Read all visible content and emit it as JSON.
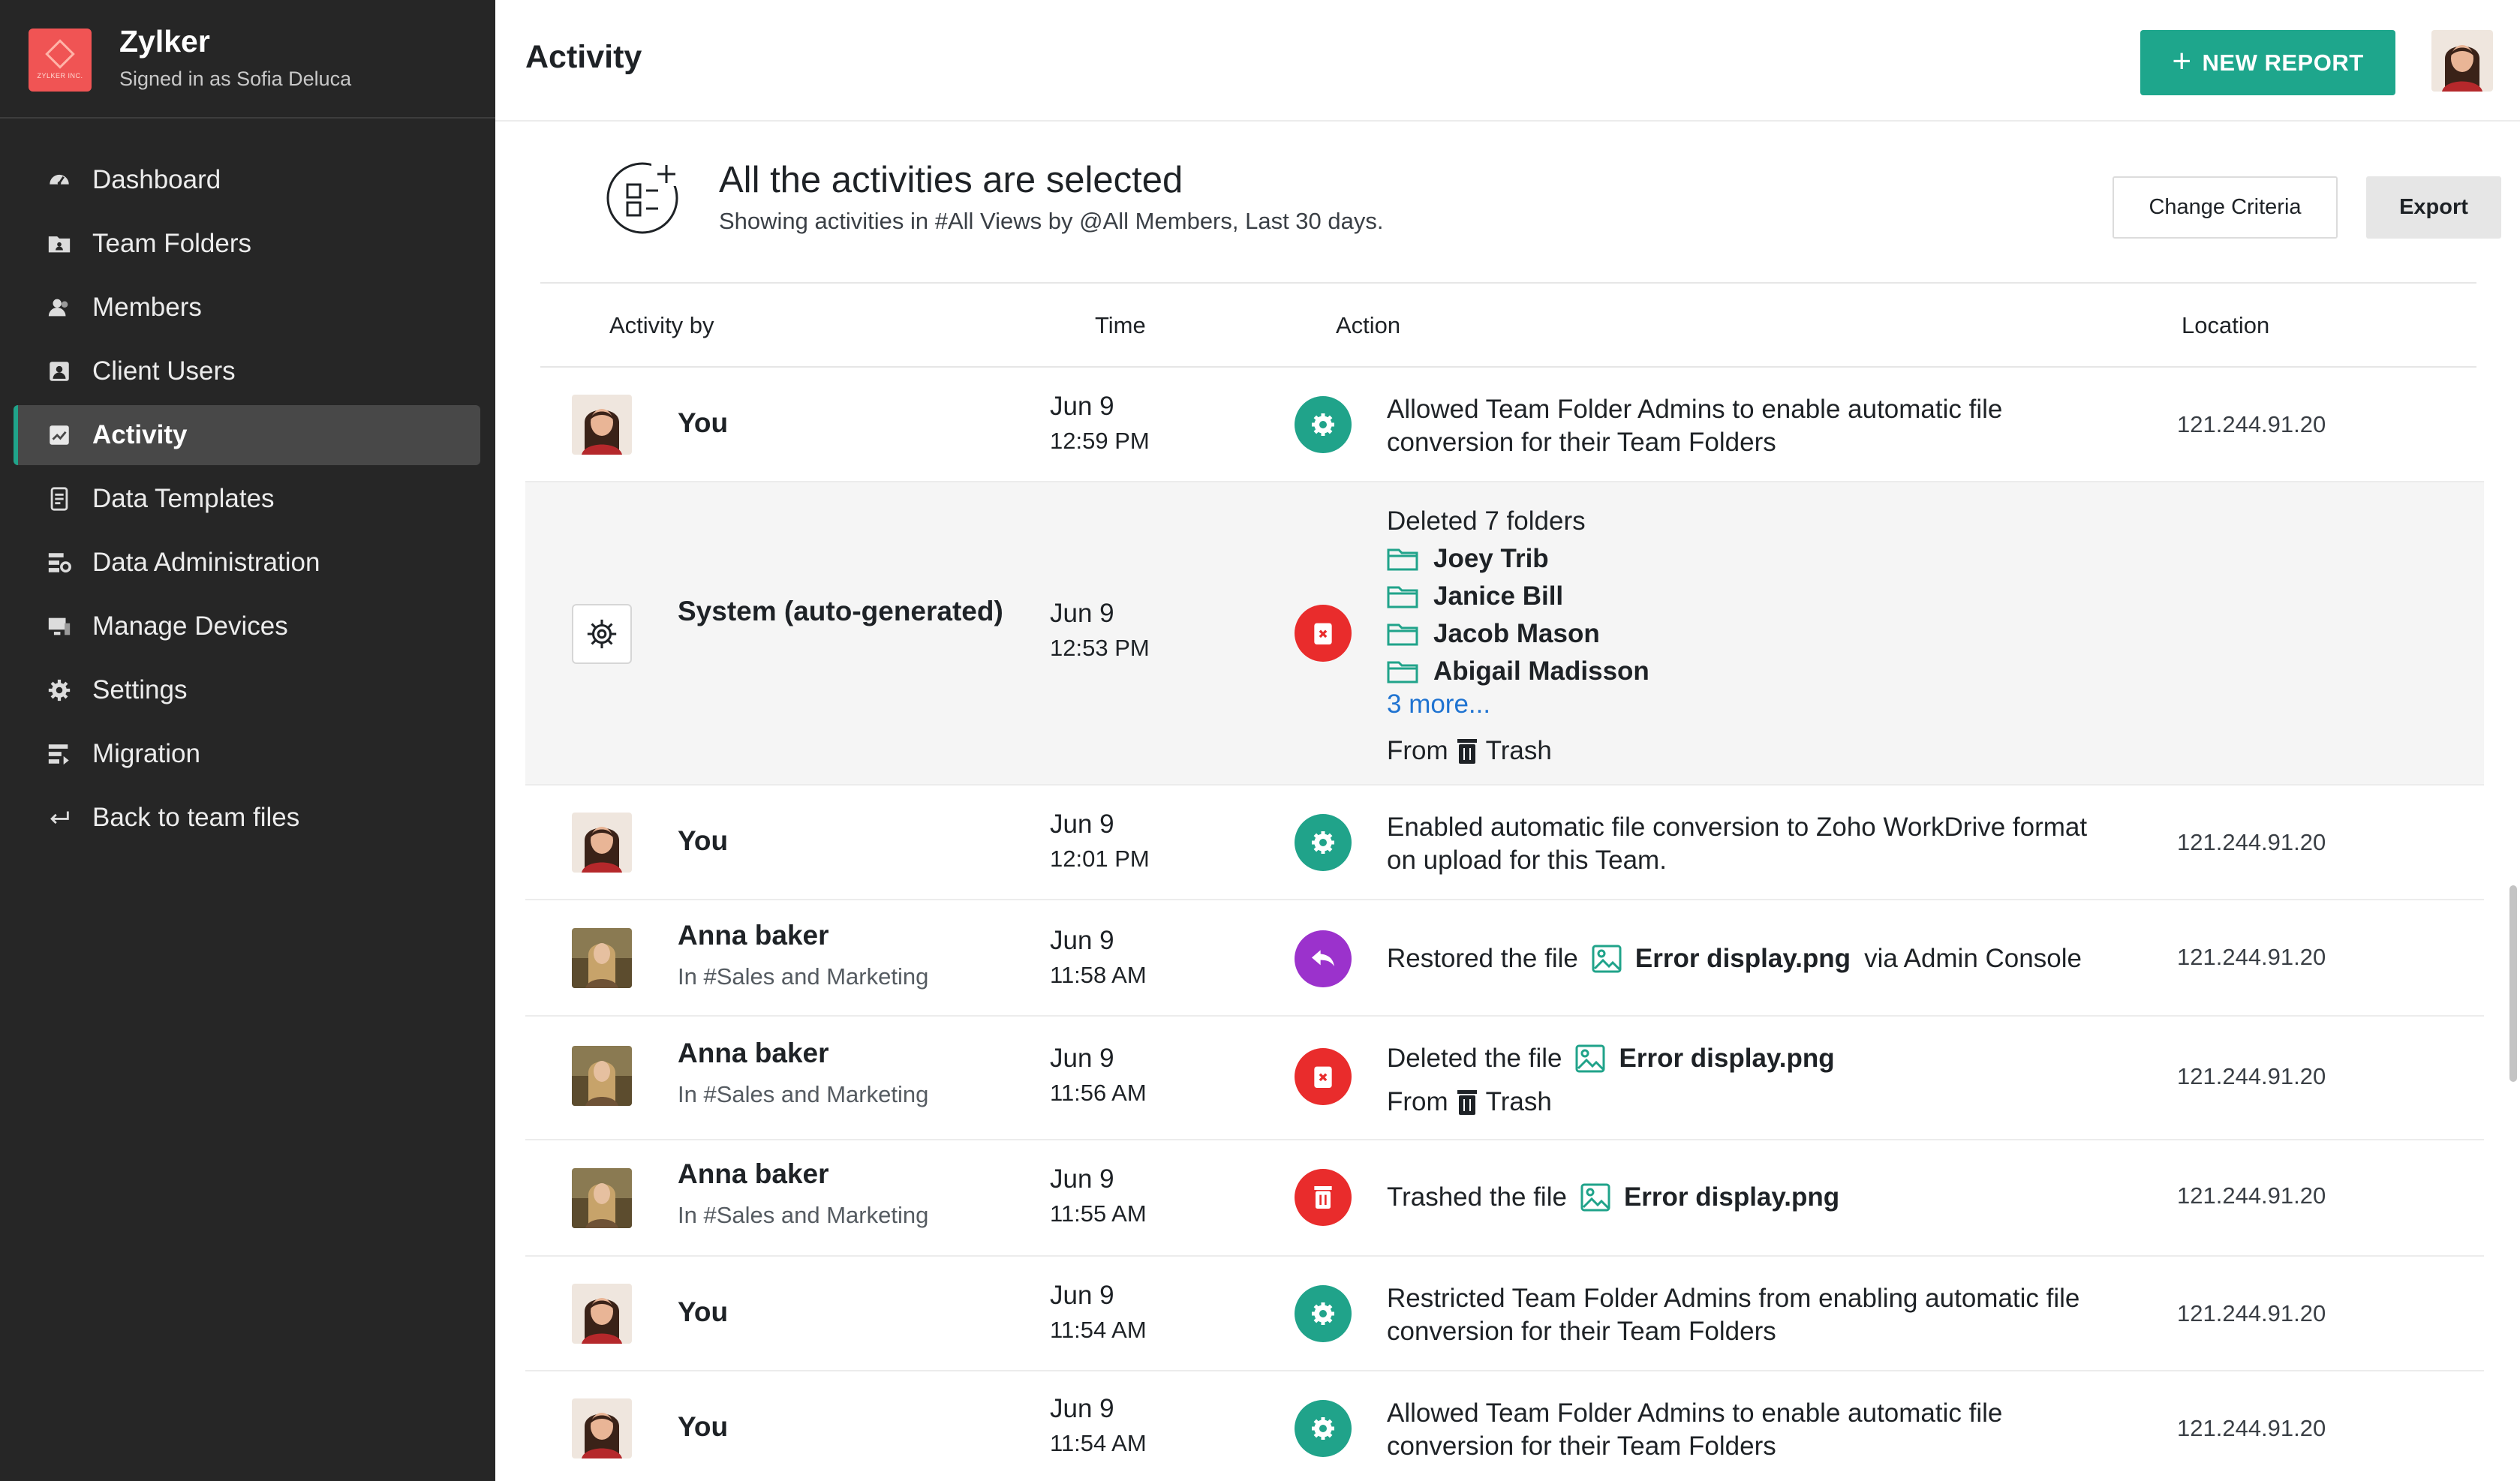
{
  "sidebar": {
    "org_name": "Zylker",
    "logo_text": "ZYLKER INC.",
    "signed_in": "Signed in as Sofia Deluca",
    "items": [
      {
        "label": "Dashboard",
        "icon": "dashboard-icon"
      },
      {
        "label": "Team Folders",
        "icon": "team-folders-icon"
      },
      {
        "label": "Members",
        "icon": "members-icon"
      },
      {
        "label": "Client Users",
        "icon": "client-users-icon"
      },
      {
        "label": "Activity",
        "icon": "activity-icon",
        "active": true
      },
      {
        "label": "Data Templates",
        "icon": "data-templates-icon"
      },
      {
        "label": "Data Administration",
        "icon": "data-administration-icon"
      },
      {
        "label": "Manage Devices",
        "icon": "manage-devices-icon"
      },
      {
        "label": "Settings",
        "icon": "settings-icon"
      },
      {
        "label": "Migration",
        "icon": "migration-icon"
      },
      {
        "label": "Back to team files",
        "icon": "back-icon"
      }
    ]
  },
  "header": {
    "title": "Activity",
    "new_report_label": "NEW REPORT"
  },
  "criteria": {
    "title": "All the activities are selected",
    "subtitle": "Showing activities in #All Views by @All Members, Last 30 days.",
    "change_criteria_label": "Change Criteria",
    "export_label": "Export"
  },
  "table": {
    "columns": [
      "Activity by",
      "Time",
      "Action",
      "Location"
    ],
    "rows": [
      {
        "actor": "You",
        "date": "Jun 9",
        "time": "12:59 PM",
        "action_icon": "settings-icon",
        "action": "Allowed Team Folder Admins to enable automatic file conversion for their Team Folders",
        "location": "121.244.91.20"
      },
      {
        "actor": "System (auto-generated)",
        "date": "Jun 9",
        "time": "12:53 PM",
        "action_icon": "delete-icon",
        "action": "Deleted 7 folders",
        "folders": [
          "Joey Trib",
          "Janice Bill",
          "Jacob Mason",
          "Abigail Madisson"
        ],
        "more": "3 more...",
        "from_prefix": "From",
        "from_location": "Trash",
        "location": ""
      },
      {
        "actor": "You",
        "date": "Jun 9",
        "time": "12:01 PM",
        "action_icon": "settings-icon",
        "action": "Enabled automatic file conversion to Zoho WorkDrive format on upload for this Team.",
        "location": "121.244.91.20"
      },
      {
        "actor": "Anna baker",
        "actor_sub": "In #Sales and Marketing",
        "date": "Jun 9",
        "time": "11:58 AM",
        "action_icon": "restore-icon",
        "action_prefix": "Restored the file",
        "file": "Error display.png",
        "action_suffix": "via Admin Console",
        "location": "121.244.91.20"
      },
      {
        "actor": "Anna baker",
        "actor_sub": "In #Sales and Marketing",
        "date": "Jun 9",
        "time": "11:56 AM",
        "action_icon": "delete-icon",
        "action_prefix": "Deleted the file",
        "file": "Error display.png",
        "from_prefix": "From",
        "from_location": "Trash",
        "location": "121.244.91.20"
      },
      {
        "actor": "Anna baker",
        "actor_sub": "In #Sales and Marketing",
        "date": "Jun 9",
        "time": "11:55 AM",
        "action_icon": "trash-icon",
        "action_prefix": "Trashed the file",
        "file": "Error display.png",
        "location": "121.244.91.20"
      },
      {
        "actor": "You",
        "date": "Jun 9",
        "time": "11:54 AM",
        "action_icon": "settings-icon",
        "action": "Restricted Team Folder Admins from enabling automatic file conversion for their Team Folders",
        "location": "121.244.91.20"
      },
      {
        "actor": "You",
        "date": "Jun 9",
        "time": "11:54 AM",
        "action_icon": "settings-icon",
        "action": "Allowed Team Folder Admins to enable automatic file conversion for their Team Folders",
        "location": "121.244.91.20"
      }
    ]
  },
  "colors": {
    "accent": "#1ea68c",
    "delete": "#e92c2c",
    "restore": "#9b32cc",
    "link": "#1f73d1",
    "sidebar_bg": "#262626"
  }
}
